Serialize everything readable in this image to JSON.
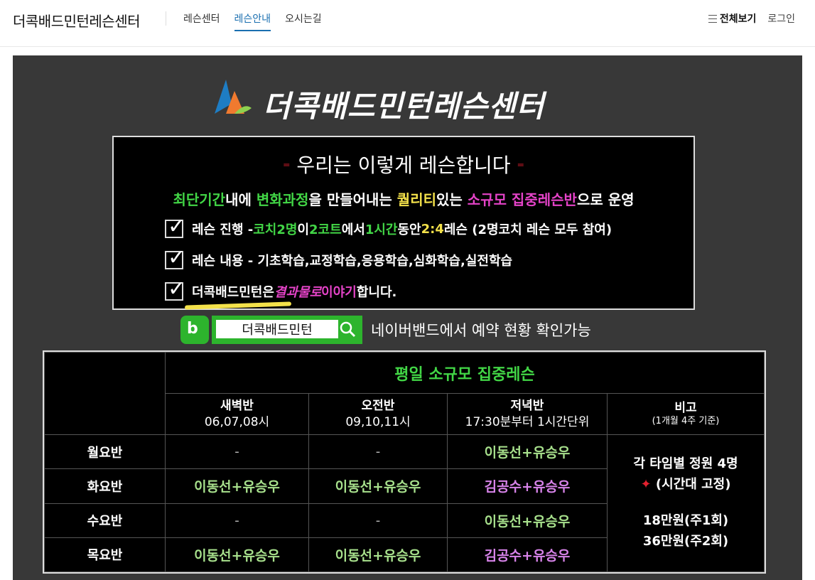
{
  "nav": {
    "brand": "더콕배드민턴레슨센터",
    "items": [
      {
        "label": "레슨센터"
      },
      {
        "label": "레슨안내"
      },
      {
        "label": "오시는길"
      }
    ],
    "active_item": "레슨안내",
    "menu_label": "전체보기",
    "login_label": "로그인"
  },
  "banner": {
    "title": "더콕배드민턴레슨센터",
    "headline": "우리는 이렇게 레슨합니다",
    "subline": {
      "p1": "최단기간",
      "p2": "내에 ",
      "p3": "변화과정",
      "p4": "을 만들어내는 ",
      "p5": "퀄리티",
      "p6": "있는 ",
      "p7": "소규모 집중레슨반",
      "p8": "으로 운영"
    },
    "checks": [
      {
        "prefix": "레슨 진행 - ",
        "g1": "코치2명",
        "t1": "이 ",
        "g2": "2코트",
        "t2": "에서 ",
        "g3": "1시간",
        "t3": "동안 ",
        "y1": "2:4",
        "t4": " 레슨 (2명코치 레슨 모두 참여)"
      },
      {
        "text": "레슨 내용 - 기초학습,교정학습,응용학습,심화학습,실전학습"
      },
      {
        "t1": "더콕배드민턴은 ",
        "m1": "결과물로 ",
        "m2": "이야기",
        "t2": "합니다."
      }
    ],
    "band": {
      "icon_letter": "b",
      "search_value": "더콕배드민턴",
      "caption": "네이버밴드에서 예약 현황 확인가능"
    },
    "table": {
      "title": "평일 소규모 집중레슨",
      "columns": [
        {
          "name": "새벽반",
          "time": "06,07,08시"
        },
        {
          "name": "오전반",
          "time": "09,10,11시"
        },
        {
          "name": "저녁반",
          "time": "17:30분부터 1시간단위"
        }
      ],
      "note_header": "비고",
      "note_sub": "(1개월 4주 기준)",
      "rows": [
        {
          "day": "월요반",
          "c1": "-",
          "c2": "-",
          "c3": "이동선+유승우"
        },
        {
          "day": "화요반",
          "c1": "이동선+유승우",
          "c2": "이동선+유승우",
          "c3": "김공수+유승우"
        },
        {
          "day": "수요반",
          "c1": "-",
          "c2": "-",
          "c3": "이동선+유승우"
        },
        {
          "day": "목요반",
          "c1": "이동선+유승우",
          "c2": "이동선+유승우",
          "c3": "김공수+유승우"
        }
      ],
      "side": {
        "line1": "각 타임별 정원 4명",
        "line2": "(시간대 고정)",
        "price1": "18만원(주1회)",
        "price2": "36만원(주2회)"
      }
    }
  },
  "colors": {
    "accent_nav": "#1a6fb0",
    "green": "#42d646",
    "yellow": "#f3e14a",
    "magenta": "#e543c8",
    "banner_bg": "#383838"
  }
}
